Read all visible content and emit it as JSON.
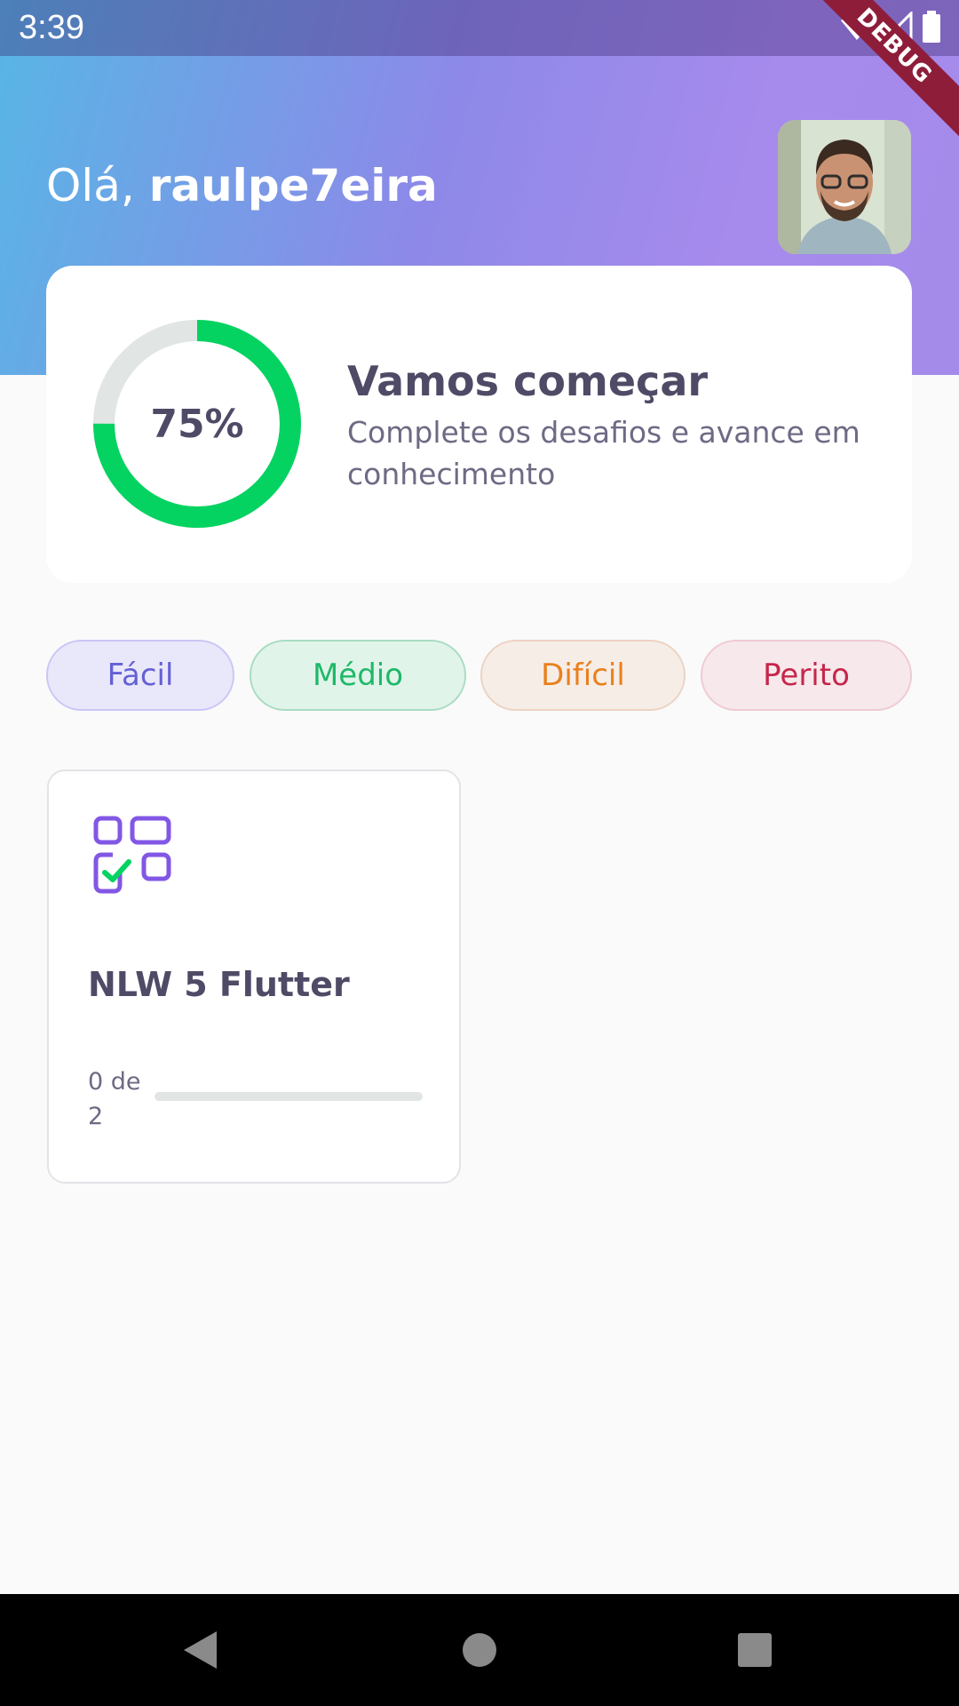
{
  "status_bar": {
    "time": "3:39",
    "debug_label": "DEBUG"
  },
  "header": {
    "greeting_prefix": "Olá, ",
    "username": "raulpe7eira",
    "avatar_icon": "user-avatar"
  },
  "score_card": {
    "percent": 75,
    "percent_label": "75%",
    "title": "Vamos começar",
    "subtitle": "Complete os desafios e avance em conhecimento"
  },
  "levels": [
    {
      "label": "Fácil"
    },
    {
      "label": "Médio"
    },
    {
      "label": "Difícil"
    },
    {
      "label": "Perito"
    }
  ],
  "quiz_cards": [
    {
      "icon": "checklist-grid-icon",
      "title": "NLW 5 Flutter",
      "progress_text": "0 de 2",
      "answered": 0,
      "total": 2
    }
  ],
  "colors": {
    "ring_progress": "#04D361",
    "ring_track": "#E1E5E4",
    "accent_purple": "#8257E5",
    "text_heading": "#4F4A66"
  },
  "nav": {
    "back_icon": "back-triangle-icon",
    "home_icon": "home-circle-icon",
    "recents_icon": "recents-square-icon"
  }
}
